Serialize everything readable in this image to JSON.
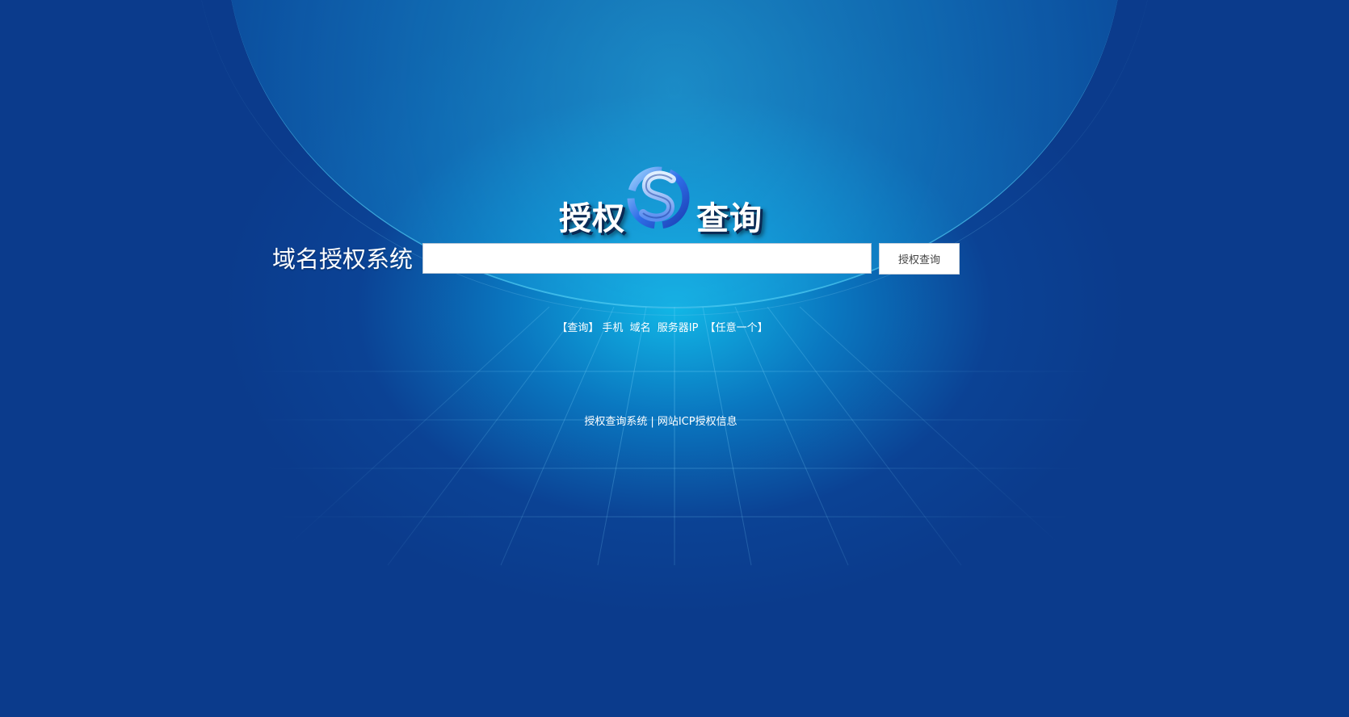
{
  "logo": {
    "left_text": "授权",
    "right_text": "查询",
    "emblem_icon": "s-swirl-logo-icon"
  },
  "search": {
    "label": "域名授权系统",
    "input_value": "",
    "placeholder": "",
    "button_label": "授权查询"
  },
  "hint": {
    "bracket_left": "【查询】",
    "item_phone": "手机",
    "item_domain": "域名",
    "item_server_ip": "服务器IP",
    "bracket_right": "【任意一个】"
  },
  "footer": {
    "link_system": "授权查询系统",
    "separator": "|",
    "link_icp": "网站ICP授权信息"
  },
  "colors": {
    "background": "#0b3b8c",
    "glow": "#12bee9",
    "text": "#ffffff"
  }
}
